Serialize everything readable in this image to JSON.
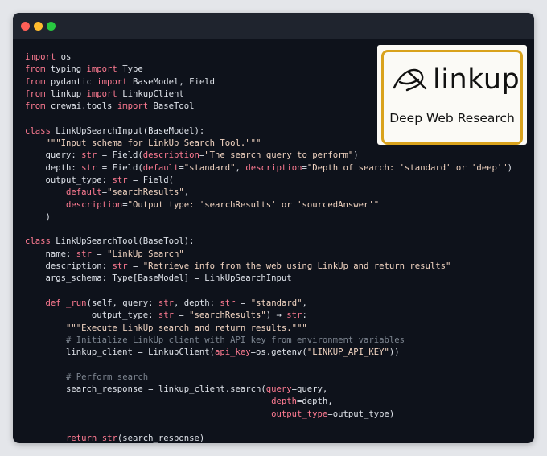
{
  "logo": {
    "wordmark": "linkup",
    "tagline": "Deep Web Research"
  },
  "code_lines": [
    [
      [
        "kw",
        "import"
      ],
      [
        "p",
        " os"
      ]
    ],
    [
      [
        "kw",
        "from"
      ],
      [
        "p",
        " typing "
      ],
      [
        "kw",
        "import"
      ],
      [
        "p",
        " Type"
      ]
    ],
    [
      [
        "kw",
        "from"
      ],
      [
        "p",
        " pydantic "
      ],
      [
        "kw",
        "import"
      ],
      [
        "p",
        " BaseModel, Field"
      ]
    ],
    [
      [
        "kw",
        "from"
      ],
      [
        "p",
        " linkup "
      ],
      [
        "kw",
        "import"
      ],
      [
        "p",
        " LinkupClient"
      ]
    ],
    [
      [
        "kw",
        "from"
      ],
      [
        "p",
        " crewai.tools "
      ],
      [
        "kw",
        "import"
      ],
      [
        "p",
        " BaseTool"
      ]
    ],
    [],
    [
      [
        "kw",
        "class"
      ],
      [
        "p",
        " LinkUpSearchInput(BaseModel):"
      ]
    ],
    [
      [
        "p",
        "    "
      ],
      [
        "str",
        "\"\"\"Input schema for LinkUp Search Tool.\"\"\""
      ]
    ],
    [
      [
        "p",
        "    query: "
      ],
      [
        "kw",
        "str"
      ],
      [
        "p",
        " = Field("
      ],
      [
        "param",
        "description"
      ],
      [
        "p",
        "="
      ],
      [
        "str",
        "\"The search query to perform\""
      ],
      [
        "p",
        ")"
      ]
    ],
    [
      [
        "p",
        "    depth: "
      ],
      [
        "kw",
        "str"
      ],
      [
        "p",
        " = Field("
      ],
      [
        "param",
        "default"
      ],
      [
        "p",
        "="
      ],
      [
        "str",
        "\"standard\""
      ],
      [
        "p",
        ", "
      ],
      [
        "param",
        "description"
      ],
      [
        "p",
        "="
      ],
      [
        "str",
        "\"Depth of search: 'standard' or 'deep'\""
      ],
      [
        "p",
        ")"
      ]
    ],
    [
      [
        "p",
        "    output_type: "
      ],
      [
        "kw",
        "str"
      ],
      [
        "p",
        " = Field("
      ]
    ],
    [
      [
        "p",
        "        "
      ],
      [
        "param",
        "default"
      ],
      [
        "p",
        "="
      ],
      [
        "str",
        "\"searchResults\""
      ],
      [
        "p",
        ","
      ]
    ],
    [
      [
        "p",
        "        "
      ],
      [
        "param",
        "description"
      ],
      [
        "p",
        "="
      ],
      [
        "str",
        "\"Output type: 'searchResults' or 'sourcedAnswer'\""
      ]
    ],
    [
      [
        "p",
        "    )"
      ]
    ],
    [],
    [
      [
        "kw",
        "class"
      ],
      [
        "p",
        " LinkUpSearchTool(BaseTool):"
      ]
    ],
    [
      [
        "p",
        "    name: "
      ],
      [
        "kw",
        "str"
      ],
      [
        "p",
        " = "
      ],
      [
        "str",
        "\"LinkUp Search\""
      ]
    ],
    [
      [
        "p",
        "    description: "
      ],
      [
        "kw",
        "str"
      ],
      [
        "p",
        " = "
      ],
      [
        "str",
        "\"Retrieve info from the web using LinkUp and return results\""
      ]
    ],
    [
      [
        "p",
        "    args_schema: Type[BaseModel] = LinkUpSearchInput"
      ]
    ],
    [],
    [
      [
        "p",
        "    "
      ],
      [
        "kw",
        "def"
      ],
      [
        "p",
        " "
      ],
      [
        "fn",
        "_run"
      ],
      [
        "p",
        "(self, query: "
      ],
      [
        "kw",
        "str"
      ],
      [
        "p",
        ", depth: "
      ],
      [
        "kw",
        "str"
      ],
      [
        "p",
        " = "
      ],
      [
        "str",
        "\"standard\""
      ],
      [
        "p",
        ","
      ]
    ],
    [
      [
        "p",
        "             output_type: "
      ],
      [
        "kw",
        "str"
      ],
      [
        "p",
        " = "
      ],
      [
        "str",
        "\"searchResults\""
      ],
      [
        "p",
        ") → "
      ],
      [
        "kw",
        "str"
      ],
      [
        "p",
        ":"
      ]
    ],
    [
      [
        "p",
        "        "
      ],
      [
        "str",
        "\"\"\"Execute LinkUp search and return results.\"\"\""
      ]
    ],
    [
      [
        "p",
        "        "
      ],
      [
        "cmt",
        "# Initialize LinkUp client with API key from environment variables"
      ]
    ],
    [
      [
        "p",
        "        linkup_client = LinkupClient("
      ],
      [
        "param",
        "api_key"
      ],
      [
        "p",
        "=os.getenv("
      ],
      [
        "str",
        "\"LINKUP_API_KEY\""
      ],
      [
        "p",
        "))"
      ]
    ],
    [],
    [
      [
        "p",
        "        "
      ],
      [
        "cmt",
        "# Perform search"
      ]
    ],
    [
      [
        "p",
        "        search_response = linkup_client.search("
      ],
      [
        "param",
        "query"
      ],
      [
        "p",
        "=query,"
      ]
    ],
    [
      [
        "p",
        "                                                "
      ],
      [
        "param",
        "depth"
      ],
      [
        "p",
        "=depth,"
      ]
    ],
    [
      [
        "p",
        "                                                "
      ],
      [
        "param",
        "output_type"
      ],
      [
        "p",
        "=output_type)"
      ]
    ],
    [],
    [
      [
        "p",
        "        "
      ],
      [
        "kw",
        "return"
      ],
      [
        "p",
        " "
      ],
      [
        "kw",
        "str"
      ],
      [
        "p",
        "(search_response)"
      ]
    ]
  ]
}
